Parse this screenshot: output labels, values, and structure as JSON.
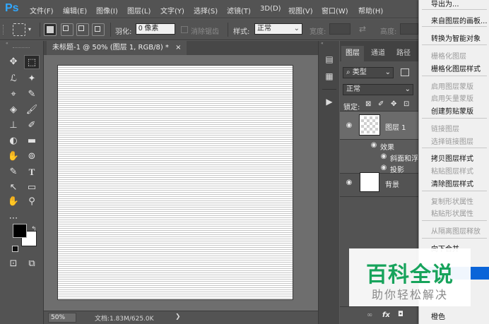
{
  "app": {
    "logo": "Ps"
  },
  "menubar": [
    "文件(F)",
    "编辑(E)",
    "图像(I)",
    "图层(L)",
    "文字(Y)",
    "选择(S)",
    "滤镜(T)",
    "3D(D)",
    "视图(V)",
    "窗口(W)",
    "帮助(H)"
  ],
  "options": {
    "feather_label": "羽化:",
    "feather_value": "0 像素",
    "antialias_label": "消除锯齿",
    "style_label": "样式:",
    "style_value": "正常",
    "width_label": "宽度:",
    "height_label": "高度:",
    "swap_glyph": "⇄"
  },
  "document": {
    "tab_title": "未标题-1 @ 50% (图层 1, RGB/8) *",
    "close_glyph": "×",
    "zoom": "50%",
    "doc_info": "文档:1.83M/625.0K",
    "status_arrow": "❯"
  },
  "toolbox": {
    "tools": [
      "✥",
      "⬚",
      "ℒ",
      "✦",
      "⌖",
      "✎",
      "◈",
      "🖌",
      "⊥",
      "✐",
      "◐",
      "▬",
      "✋",
      "⊚",
      "✎",
      "T",
      "↖",
      "▭",
      "✋",
      "⚲",
      "⋯"
    ],
    "extra": [
      "⊡",
      "⧉"
    ]
  },
  "layers_panel": {
    "tabs": [
      "图层",
      "通道",
      "路径"
    ],
    "filter_label": "⌕ 类型",
    "blend_mode": "正常",
    "lock_label": "锁定:",
    "lock_icons": [
      "⊠",
      "✐",
      "✥",
      "⊡"
    ],
    "layers": [
      {
        "name": "图层 1",
        "effects_label": "效果",
        "effects": [
          "斜面和浮雕",
          "投影"
        ]
      },
      {
        "name": "背景"
      }
    ],
    "bottom_icons": [
      "∞",
      "fx",
      "◘"
    ]
  },
  "context_menu": {
    "items_top": [
      {
        "label": "导出为...",
        "enabled": true
      },
      {
        "label": "来自图层的画板...",
        "enabled": true
      },
      {
        "label": "转换为智能对象",
        "enabled": true
      },
      {
        "label": "栅格化图层",
        "enabled": false
      },
      {
        "label": "栅格化图层样式",
        "enabled": true
      },
      {
        "label": "启用图层蒙版",
        "enabled": false
      },
      {
        "label": "启用矢量蒙版",
        "enabled": false
      },
      {
        "label": "创建剪贴蒙版",
        "enabled": true
      },
      {
        "label": "链接图层",
        "enabled": false
      },
      {
        "label": "选择链接图层",
        "enabled": false
      },
      {
        "label": "拷贝图层样式",
        "enabled": true
      },
      {
        "label": "粘贴图层样式",
        "enabled": false
      },
      {
        "label": "清除图层样式",
        "enabled": true
      },
      {
        "label": "复制形状属性",
        "enabled": false
      },
      {
        "label": "粘贴形状属性",
        "enabled": false
      },
      {
        "label": "从隔离图层释放",
        "enabled": false
      },
      {
        "label": "向下合并",
        "enabled": true
      }
    ],
    "bottom_item": "橙色"
  },
  "watermark": {
    "title": "百科全说",
    "subtitle": "助你轻松解决"
  },
  "colors": {
    "accent": "#31a8ff",
    "highlight": "#0a64d8",
    "watermark_green": "#17a35b"
  }
}
